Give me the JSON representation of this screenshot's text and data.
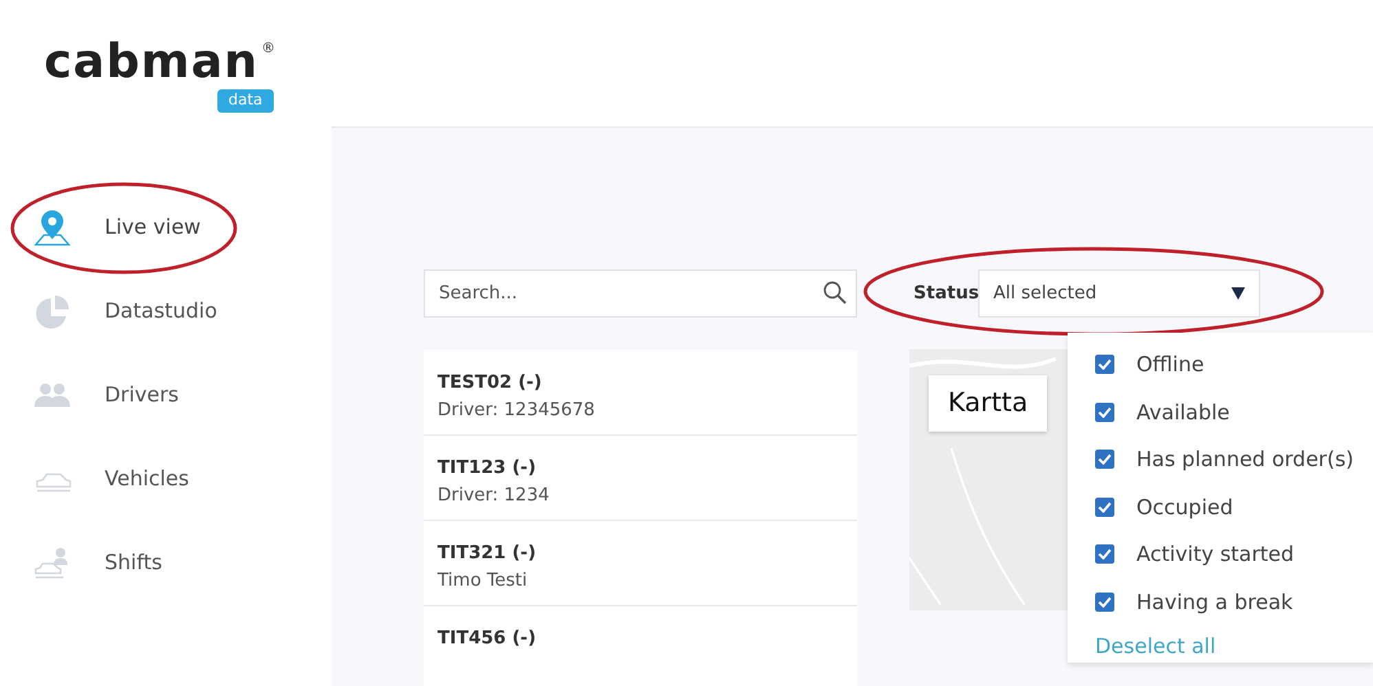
{
  "logo": {
    "wordmark": "cabman",
    "trademark": "®",
    "badge": "data"
  },
  "sidebar": {
    "items": [
      {
        "label": "Live view",
        "kind": "pin",
        "selected": true,
        "circled": true
      },
      {
        "label": "Datastudio",
        "kind": "pie",
        "selected": false,
        "circled": false
      },
      {
        "label": "Drivers",
        "kind": "people",
        "selected": false,
        "circled": false
      },
      {
        "label": "Vehicles",
        "kind": "car",
        "selected": false,
        "circled": false
      },
      {
        "label": "Shifts",
        "kind": "shift",
        "selected": false,
        "circled": false
      }
    ]
  },
  "search": {
    "placeholder": "Search..."
  },
  "vehicles": [
    {
      "title": "TEST02 (-)",
      "subtitle": "Driver: 12345678"
    },
    {
      "title": "TIT123 (-)",
      "subtitle": "Driver: 1234"
    },
    {
      "title": "TIT321 (-)",
      "subtitle": "Timo Testi"
    },
    {
      "title": "TIT456 (-)"
    }
  ],
  "status_filter": {
    "label": "Status",
    "value": "All selected",
    "circled": true,
    "expanded": true,
    "options": [
      {
        "label": "Offline",
        "checked": true
      },
      {
        "label": "Available",
        "checked": true
      },
      {
        "label": "Has planned order(s)",
        "checked": true
      },
      {
        "label": "Occupied",
        "checked": true
      },
      {
        "label": "Activity started",
        "checked": true
      },
      {
        "label": "Having a break",
        "checked": true
      }
    ],
    "deselect_link": "Deselect all"
  },
  "map": {
    "button": "Kartta"
  }
}
